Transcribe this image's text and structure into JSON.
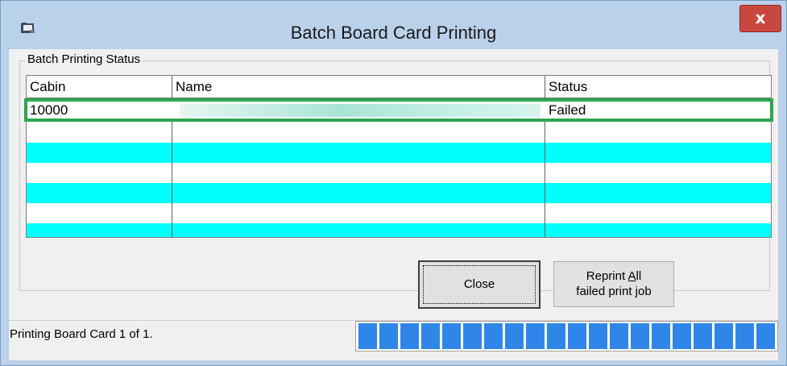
{
  "window": {
    "title": "Batch Board Card Printing",
    "close_glyph": "x",
    "icon": "card-window-icon"
  },
  "group": {
    "label": "Batch Printing Status"
  },
  "table": {
    "columns": [
      "Cabin",
      "Name",
      "Status"
    ],
    "rows": [
      {
        "cabin": "10000",
        "name": "[redacted]",
        "status": "Failed",
        "selected": true
      }
    ],
    "stripe_colors": [
      "#ffffff",
      "#00ffff"
    ],
    "selection_color": "#2ea54d"
  },
  "buttons": {
    "close_label": "Close",
    "reprint_line1_prefix": "Reprint ",
    "reprint_line1_mnemonic": "A",
    "reprint_line1_suffix": "ll",
    "reprint_line2": "failed print job"
  },
  "status": {
    "text": "Printing Board Card 1 of 1.",
    "progress_percent": 100,
    "progress_color": "#2f86e8"
  }
}
